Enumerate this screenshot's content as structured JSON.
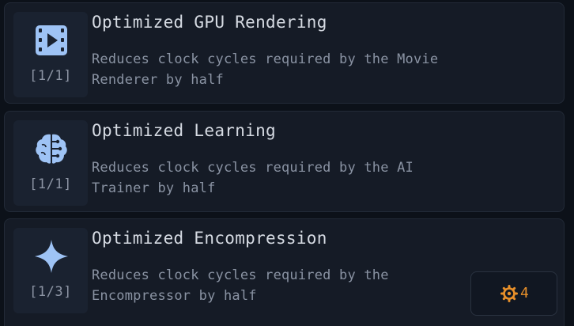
{
  "upgrades": [
    {
      "title": "Optimized GPU Rendering",
      "description": "Reduces clock cycles required by the Movie Renderer by half",
      "level": "[1/1]",
      "icon": "video-icon"
    },
    {
      "title": "Optimized Learning",
      "description": "Reduces clock cycles required by the AI Trainer by half",
      "level": "[1/1]",
      "icon": "brain-circuit-icon"
    },
    {
      "title": "Optimized Encompression",
      "description": "Reduces clock cycles required by the Encompressor by half",
      "level": "[1/3]",
      "icon": "sparkle-icon"
    }
  ],
  "cost": {
    "value": "4",
    "icon": "orange-gear-icon"
  },
  "colors": {
    "icon_fill": "#9ec3f5",
    "accent_orange": "#e8902a",
    "card_bg": "#151b26"
  }
}
